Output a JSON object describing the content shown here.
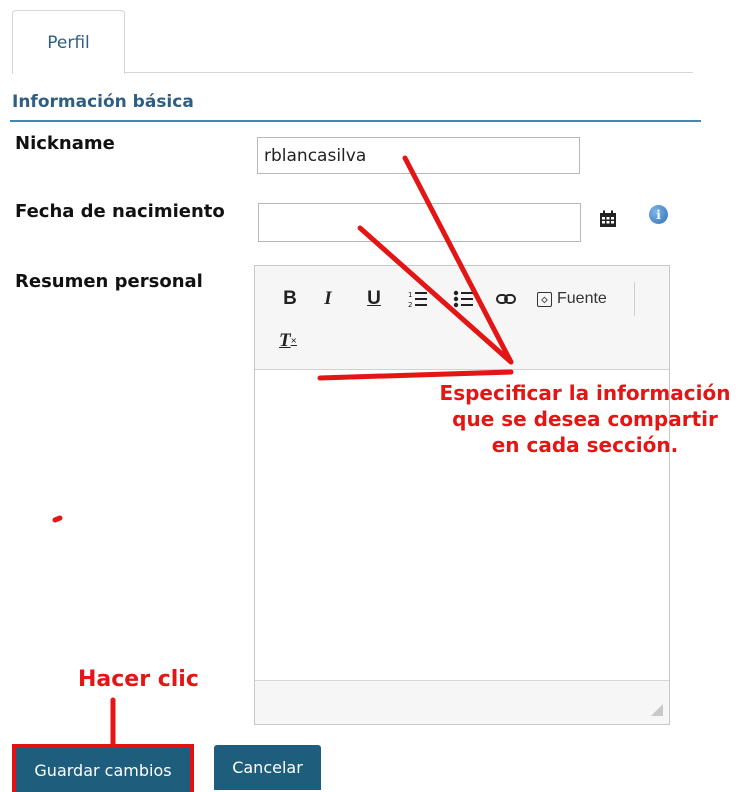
{
  "tabs": [
    {
      "label": "Perfil"
    }
  ],
  "section": {
    "title": "Información básica"
  },
  "fields": {
    "nickname": {
      "label": "Nickname",
      "value": "rblancasilva"
    },
    "birthdate": {
      "label": "Fecha de nacimiento",
      "value": ""
    },
    "summary": {
      "label": "Resumen personal"
    }
  },
  "editor": {
    "toolbar": {
      "bold": "B",
      "italic": "I",
      "underline": "U",
      "source_label": "Fuente",
      "clear_format": "T"
    },
    "icons": [
      "bold-icon",
      "italic-icon",
      "underline-icon",
      "numbered-list-icon",
      "bulleted-list-icon",
      "link-icon",
      "source-icon",
      "remove-format-icon"
    ]
  },
  "icons": {
    "calendar": "calendar-icon",
    "info": "info-icon"
  },
  "buttons": {
    "save": "Guardar cambios",
    "cancel": "Cancelar"
  },
  "annotations": {
    "click": "Hacer clic",
    "specify": [
      "Especificar la información",
      "que se desea compartir",
      "en cada sección."
    ]
  },
  "colors": {
    "accent": "#1f5d7d",
    "title": "#2e5f83",
    "annotation": "#e41515"
  }
}
